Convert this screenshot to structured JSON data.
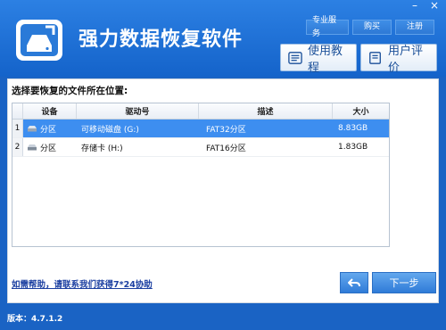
{
  "app": {
    "title": "强力数据恢复软件",
    "version": "版本：4.7.1.2"
  },
  "header": {
    "top_buttons": [
      "专业服务",
      "购买",
      "注册"
    ],
    "tutorial_label": "使用教程",
    "review_label": "用户评价"
  },
  "main": {
    "prompt": "选择要恢复的文件所在位置:",
    "columns": [
      "设备",
      "驱动号",
      "描述",
      "大小"
    ],
    "rows": [
      {
        "index": "1",
        "device": "分区",
        "drive": "可移动磁盘 (G:)",
        "description": "FAT32分区",
        "size": "8.83GB",
        "selected": true
      },
      {
        "index": "2",
        "device": "分区",
        "drive": "存储卡 (H:)",
        "description": "FAT16分区",
        "size": "1.83GB",
        "selected": false
      }
    ],
    "help_link": "如需帮助，请联系我们获得7*24协助",
    "next_label": "下一步"
  },
  "colors": {
    "header_top": "#2c80e3",
    "header_bottom": "#1463ca",
    "selection": "#3d8ef0"
  }
}
